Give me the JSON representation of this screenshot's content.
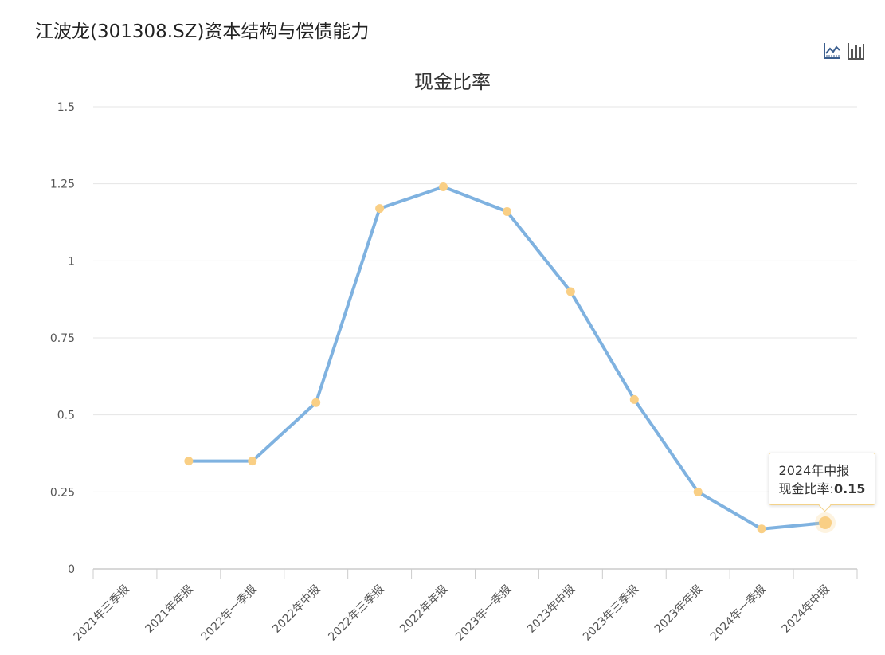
{
  "header": {
    "title": "江波龙(301308.SZ)资本结构与偿债能力"
  },
  "toolbar": {
    "line_icon": "line-chart-icon",
    "bar_icon": "bar-chart-icon"
  },
  "tooltip": {
    "category": "2024年中报",
    "series_label": "现金比率:",
    "value": "0.15"
  },
  "colors": {
    "line": "#7fb2e0",
    "marker": "#f9cf85",
    "grid": "#e4e4e4",
    "axis": "#cccccc"
  },
  "chart_data": {
    "type": "line",
    "title": "现金比率",
    "categories": [
      "2021年三季报",
      "2021年年报",
      "2022年一季报",
      "2022年中报",
      "2022年三季报",
      "2022年年报",
      "2023年一季报",
      "2023年中报",
      "2023年三季报",
      "2023年年报",
      "2024年一季报",
      "2024年中报"
    ],
    "series": [
      {
        "name": "现金比率",
        "values": [
          null,
          0.35,
          0.35,
          0.54,
          1.17,
          1.24,
          1.16,
          0.9,
          0.55,
          0.25,
          0.13,
          0.15
        ]
      }
    ],
    "ylim": [
      0,
      1.5
    ],
    "yticks": [
      0,
      0.25,
      0.5,
      0.75,
      1,
      1.25,
      1.5
    ],
    "ytick_labels": [
      "0",
      "0.25",
      "0.5",
      "0.75",
      "1",
      "1.25",
      "1.5"
    ],
    "grid": true,
    "highlight_index": 11
  }
}
